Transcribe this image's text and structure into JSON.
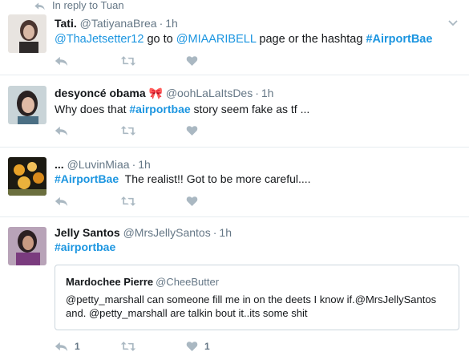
{
  "reply_context": {
    "label": "In reply to Tuan"
  },
  "tweets": [
    {
      "name": "Tati.",
      "handle": "@TatiyanaBrea",
      "time": "1h",
      "text_parts": [
        "@ThaJetsetter12",
        " go to ",
        "@MIAARIBELL",
        " page or the hashtag ",
        "#AirportBae"
      ],
      "reply_count": "",
      "retweet_count": "",
      "like_count": ""
    },
    {
      "name": "desyoncé obama",
      "emoji": "🎀",
      "handle": "@oohLaLaItsDes",
      "time": "1h",
      "text_parts": [
        "Why does that ",
        "#airportbae",
        " story seem fake as tf ..."
      ],
      "reply_count": "",
      "retweet_count": "",
      "like_count": ""
    },
    {
      "name": "...",
      "handle": "@LuvinMiaa",
      "time": "1h",
      "text_parts": [
        "#AirportBae",
        "  The realist!! Got to be more careful...."
      ],
      "reply_count": "",
      "retweet_count": "",
      "like_count": ""
    },
    {
      "name": "Jelly Santos",
      "handle": "@MrsJellySantos",
      "time": "1h",
      "text_parts": [
        "#airportbae"
      ],
      "quote": {
        "name": "Mardochee Pierre",
        "handle": "@CheeButter",
        "text": "@petty_marshall can someone fill me in on the deets I know if.@MrsJellySantos and.  @petty_marshall are talkin bout it..its some shit"
      },
      "reply_count": "1",
      "retweet_count": "",
      "like_count": "1"
    }
  ],
  "icons": {
    "reply": "reply-icon",
    "retweet": "retweet-icon",
    "like": "heart-icon",
    "more": "chevron-down-icon"
  },
  "colors": {
    "link": "#1b95e0",
    "muted": "#657786",
    "icon": "#aab8c2",
    "border": "#e6ecf0"
  }
}
